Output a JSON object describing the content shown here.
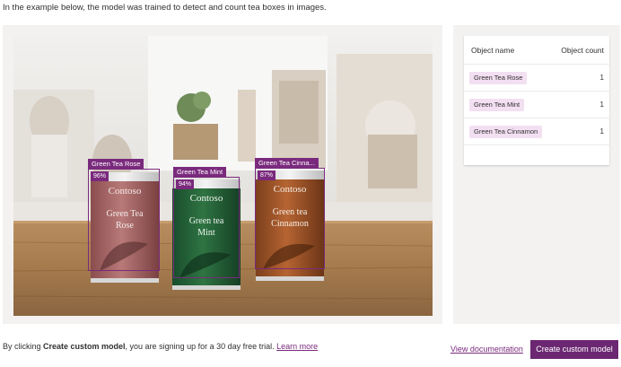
{
  "intro_text": "In the example below, the model was trained to detect and count tea boxes in images.",
  "colors": {
    "accent": "#6b2772",
    "detect_border": "#7a2a7d",
    "tag_bg": "#f3dff2",
    "panel_bg": "#f3f2f1"
  },
  "image": {
    "detections": [
      {
        "label": "Green Tea Rose",
        "confidence": "96%",
        "can_text": [
          "Contoso",
          "Green Tea",
          "Rose"
        ]
      },
      {
        "label": "Green Tea Mint",
        "confidence": "94%",
        "can_text": [
          "Contoso",
          "Green tea",
          "Mint"
        ]
      },
      {
        "label": "Green Tea Cinna...",
        "confidence": "87%",
        "can_text": [
          "Contoso",
          "Green tea",
          "Cinnamon"
        ]
      }
    ]
  },
  "table": {
    "col_name": "Object name",
    "col_count": "Object count",
    "rows": [
      {
        "name": "Green Tea Rose",
        "count": "1"
      },
      {
        "name": "Green Tea Mint",
        "count": "1"
      },
      {
        "name": "Green Tea Cinnamon",
        "count": "1"
      }
    ]
  },
  "footer": {
    "text_before": "By clicking ",
    "text_bold": "Create custom model",
    "text_after": ", you are signing up for a 30 day free trial. ",
    "learn_more": "Learn more",
    "view_documentation": "View documentation",
    "create_button": "Create custom model"
  }
}
